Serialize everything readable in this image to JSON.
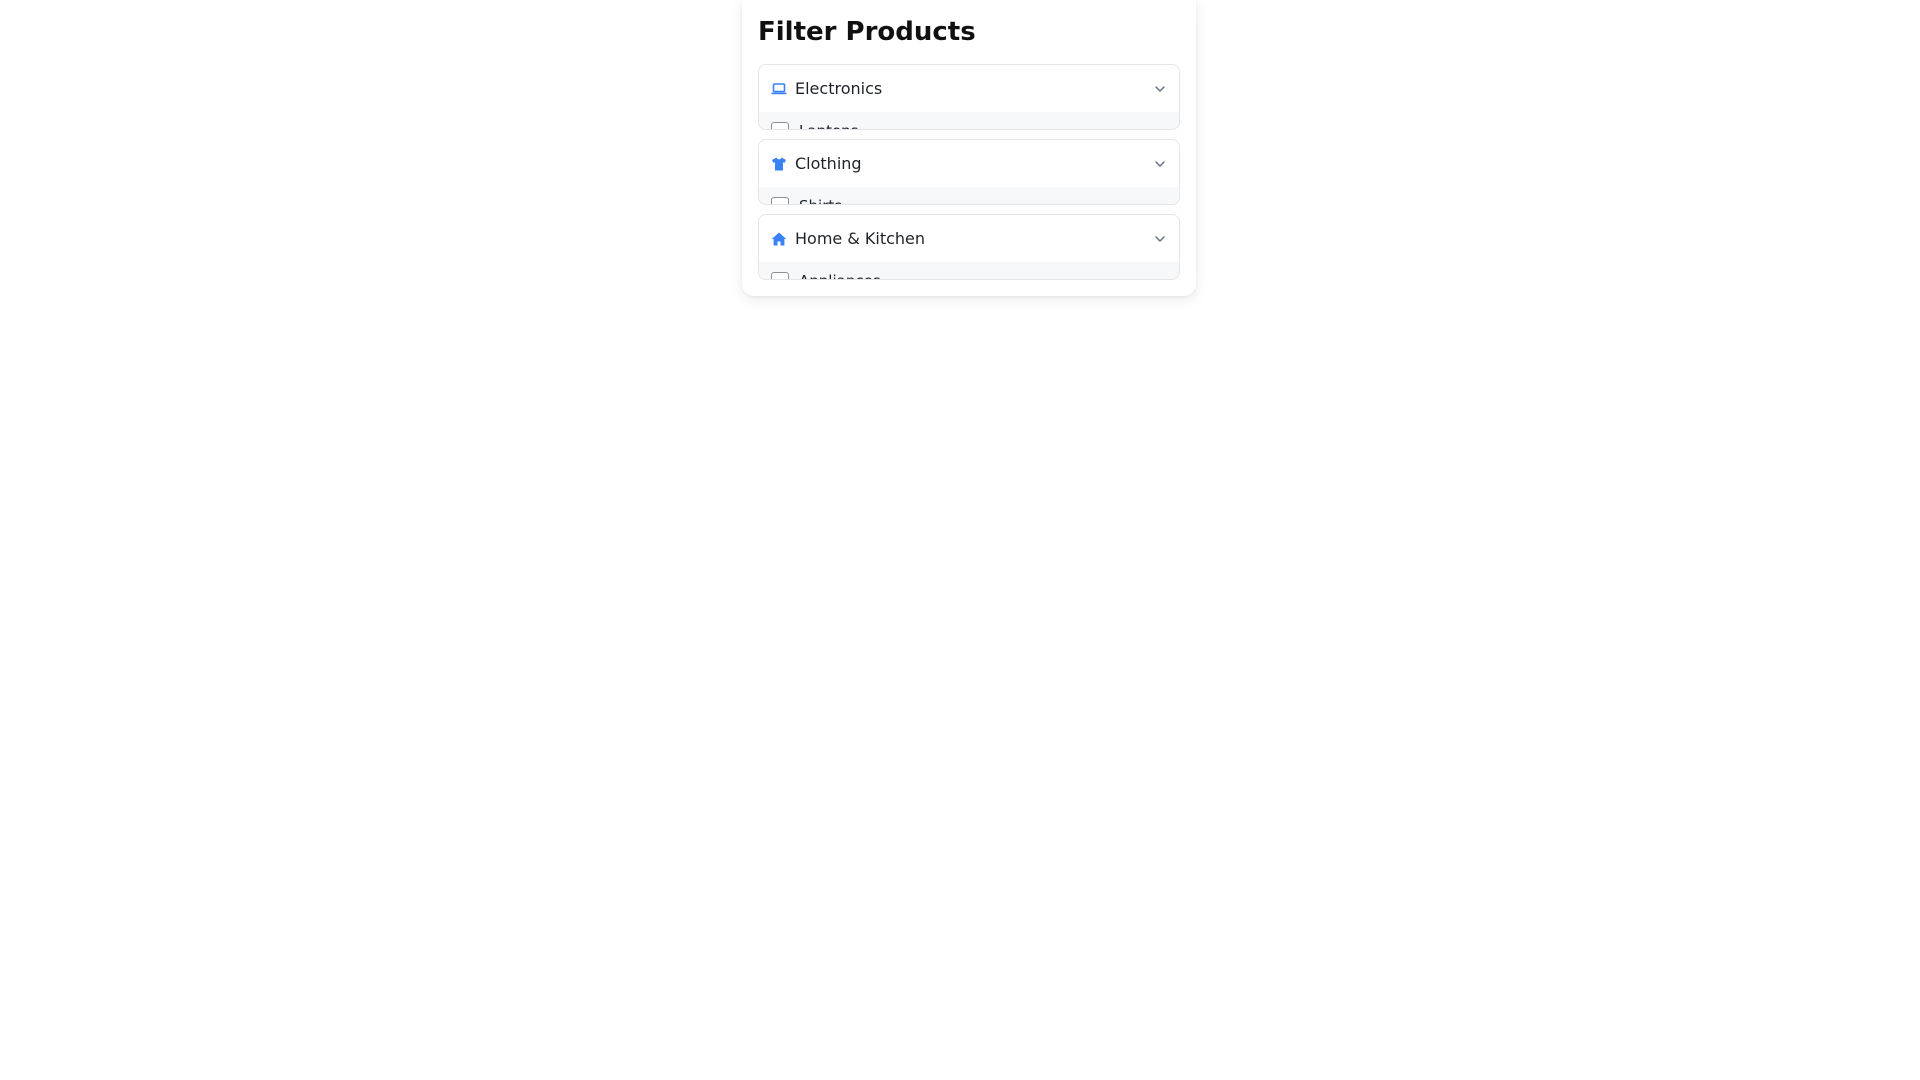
{
  "panel": {
    "title": "Filter Products",
    "accent_color": "#3b82f6",
    "categories": [
      {
        "label": "Electronics",
        "icon": "laptop-icon",
        "expanded": true,
        "options": [
          {
            "label": "Laptops",
            "checked": false
          }
        ]
      },
      {
        "label": "Clothing",
        "icon": "shirt-icon",
        "expanded": true,
        "options": [
          {
            "label": "Shirts",
            "checked": false
          }
        ]
      },
      {
        "label": "Home & Kitchen",
        "icon": "home-icon",
        "expanded": true,
        "options": [
          {
            "label": "Appliances",
            "checked": false
          }
        ]
      }
    ]
  }
}
